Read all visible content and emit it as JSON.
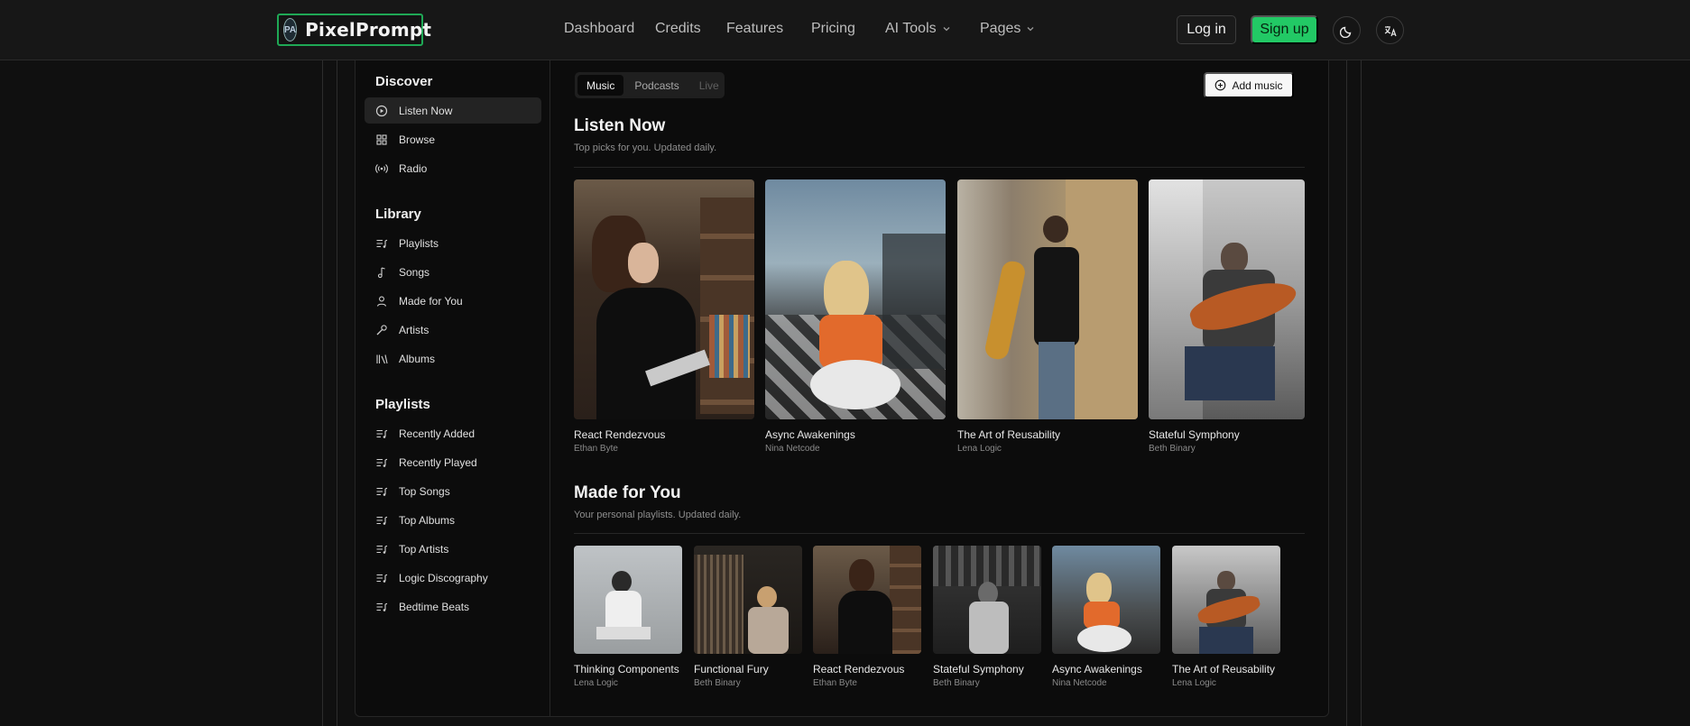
{
  "brand": {
    "logo_badge": "PA",
    "name": "PixelPrompt",
    "accent": "#22c965"
  },
  "nav": {
    "items": [
      {
        "label": "Dashboard"
      },
      {
        "label": "Credits"
      },
      {
        "label": "Features"
      },
      {
        "label": "Pricing"
      },
      {
        "label": "AI Tools",
        "dropdown": true
      },
      {
        "label": "Pages",
        "dropdown": true
      }
    ],
    "login": "Log in",
    "signup": "Sign up",
    "theme_icon": "moon-icon",
    "language_icon": "translate-icon"
  },
  "sidebar": {
    "sections": [
      {
        "heading": "Discover",
        "items": [
          {
            "label": "Listen Now",
            "icon": "play-circle-icon",
            "active": true
          },
          {
            "label": "Browse",
            "icon": "grid-icon"
          },
          {
            "label": "Radio",
            "icon": "radio-icon"
          }
        ]
      },
      {
        "heading": "Library",
        "items": [
          {
            "label": "Playlists",
            "icon": "list-music-icon"
          },
          {
            "label": "Songs",
            "icon": "music-note-icon"
          },
          {
            "label": "Made for You",
            "icon": "user-icon"
          },
          {
            "label": "Artists",
            "icon": "microphone-icon"
          },
          {
            "label": "Albums",
            "icon": "library-icon"
          }
        ]
      },
      {
        "heading": "Playlists",
        "items": [
          {
            "label": "Recently Added",
            "icon": "list-music-icon"
          },
          {
            "label": "Recently Played",
            "icon": "list-music-icon"
          },
          {
            "label": "Top Songs",
            "icon": "list-music-icon"
          },
          {
            "label": "Top Albums",
            "icon": "list-music-icon"
          },
          {
            "label": "Top Artists",
            "icon": "list-music-icon"
          },
          {
            "label": "Logic Discography",
            "icon": "list-music-icon"
          },
          {
            "label": "Bedtime Beats",
            "icon": "list-music-icon"
          }
        ]
      }
    ]
  },
  "tabs": [
    {
      "label": "Music",
      "active": true
    },
    {
      "label": "Podcasts"
    },
    {
      "label": "Live",
      "disabled": true
    }
  ],
  "add_music": "Add music",
  "listen_now": {
    "title": "Listen Now",
    "subtitle": "Top picks for you. Updated daily.",
    "albums": [
      {
        "title": "React Rendezvous",
        "artist": "Ethan Byte"
      },
      {
        "title": "Async Awakenings",
        "artist": "Nina Netcode"
      },
      {
        "title": "The Art of Reusability",
        "artist": "Lena Logic"
      },
      {
        "title": "Stateful Symphony",
        "artist": "Beth Binary"
      }
    ]
  },
  "made_for_you": {
    "title": "Made for You",
    "subtitle": "Your personal playlists. Updated daily.",
    "albums": [
      {
        "title": "Thinking Components",
        "artist": "Lena Logic"
      },
      {
        "title": "Functional Fury",
        "artist": "Beth Binary"
      },
      {
        "title": "React Rendezvous",
        "artist": "Ethan Byte"
      },
      {
        "title": "Stateful Symphony",
        "artist": "Beth Binary"
      },
      {
        "title": "Async Awakenings",
        "artist": "Nina Netcode"
      },
      {
        "title": "The Art of Reusability",
        "artist": "Lena Logic"
      }
    ]
  }
}
